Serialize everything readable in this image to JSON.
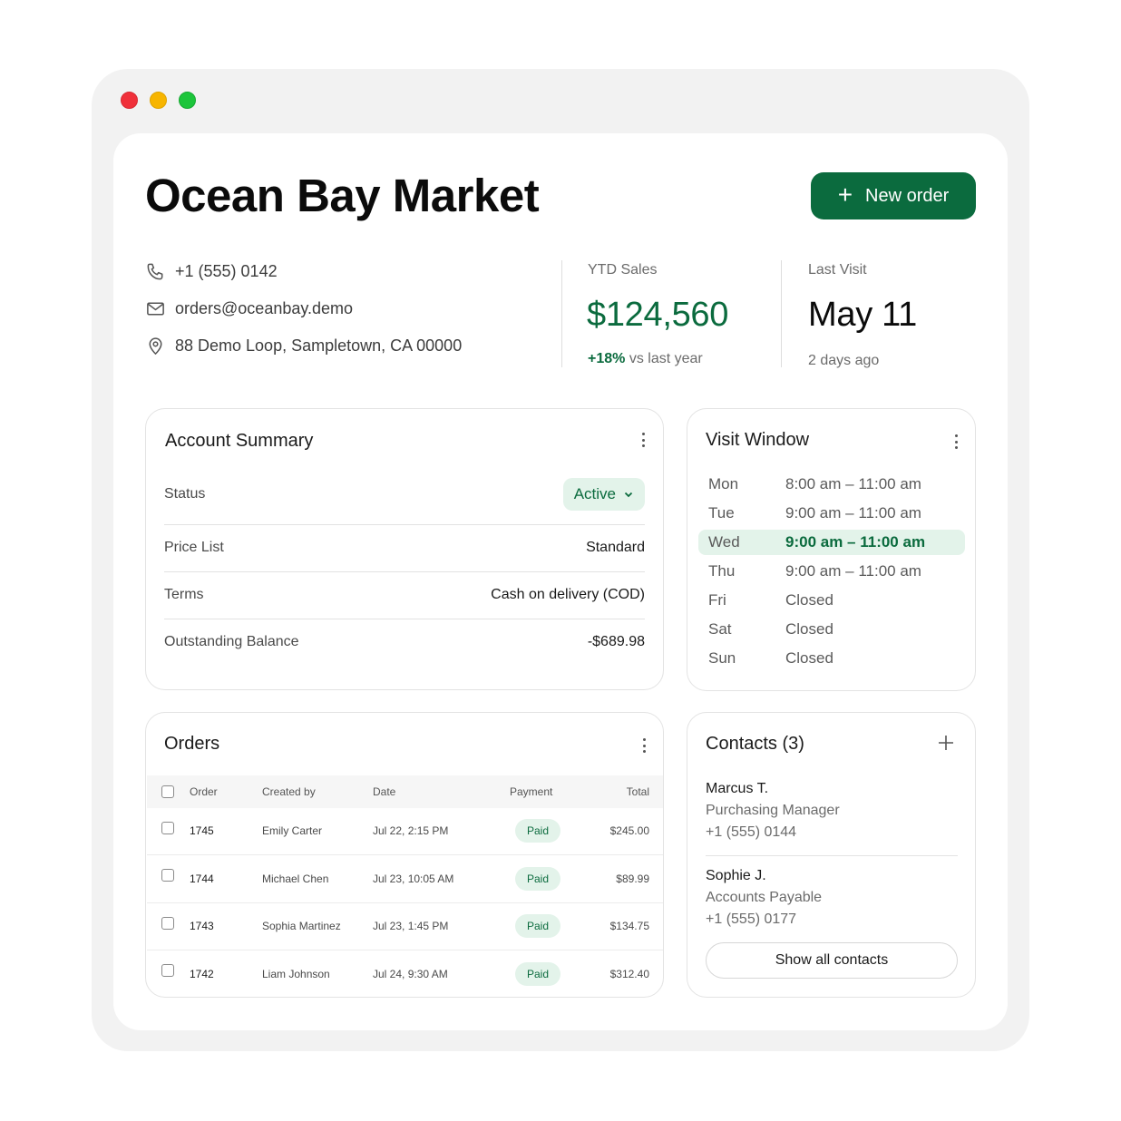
{
  "header": {
    "title": "Ocean Bay Market",
    "new_order_label": "New order"
  },
  "contact_info": {
    "phone": "+1 (555) 0142",
    "email": "orders@oceanbay.demo",
    "address": "88 Demo Loop, Sampletown, CA 00000"
  },
  "stats": {
    "ytd": {
      "label": "YTD Sales",
      "value": "$124,560",
      "change": "+18%",
      "change_suffix": " vs last year"
    },
    "last_visit": {
      "label": "Last Visit",
      "value": "May 11",
      "sub": "2 days ago"
    }
  },
  "account_summary": {
    "title": "Account Summary",
    "status_label": "Status",
    "status_value": "Active",
    "price_list_label": "Price List",
    "price_list_value": "Standard",
    "terms_label": "Terms",
    "terms_value": "Cash on delivery (COD)",
    "balance_label": "Outstanding Balance",
    "balance_value": "-$689.98"
  },
  "visit_window": {
    "title": "Visit Window",
    "days": [
      {
        "day": "Mon",
        "hours": "8:00 am – 11:00 am"
      },
      {
        "day": "Tue",
        "hours": "9:00 am – 11:00 am"
      },
      {
        "day": "Wed",
        "hours": "9:00 am – 11:00 am"
      },
      {
        "day": "Thu",
        "hours": "9:00 am – 11:00 am"
      },
      {
        "day": "Fri",
        "hours": "Closed"
      },
      {
        "day": "Sat",
        "hours": "Closed"
      },
      {
        "day": "Sun",
        "hours": "Closed"
      }
    ]
  },
  "orders": {
    "title": "Orders",
    "columns": {
      "order": "Order",
      "created_by": "Created by",
      "date": "Date",
      "payment": "Payment",
      "total": "Total"
    },
    "rows": [
      {
        "order": "1745",
        "created_by": "Emily Carter",
        "date": "Jul 22, 2:15 PM",
        "payment": "Paid",
        "total": "$245.00"
      },
      {
        "order": "1744",
        "created_by": "Michael Chen",
        "date": "Jul 23, 10:05 AM",
        "payment": "Paid",
        "total": "$89.99"
      },
      {
        "order": "1743",
        "created_by": "Sophia Martinez",
        "date": "Jul 23, 1:45 PM",
        "payment": "Paid",
        "total": "$134.75"
      },
      {
        "order": "1742",
        "created_by": "Liam Johnson",
        "date": "Jul 24, 9:30 AM",
        "payment": "Paid",
        "total": "$312.40"
      }
    ]
  },
  "contacts": {
    "title": "Contacts (3)",
    "people": [
      {
        "name": "Marcus T.",
        "role": "Purchasing Manager",
        "phone": "+1 (555) 0144"
      },
      {
        "name": "Sophie J.",
        "role": "Accounts Payable",
        "phone": "+1 (555) 0177"
      }
    ],
    "show_all_label": "Show all contacts"
  },
  "colors": {
    "accent": "#0b6b3e",
    "accent_soft": "#e3f3ea"
  },
  "icons": [
    "plus-icon",
    "phone-icon",
    "mail-icon",
    "location-pin-icon",
    "kebab-menu-icon",
    "chevron-down-icon",
    "checkbox-icon"
  ]
}
